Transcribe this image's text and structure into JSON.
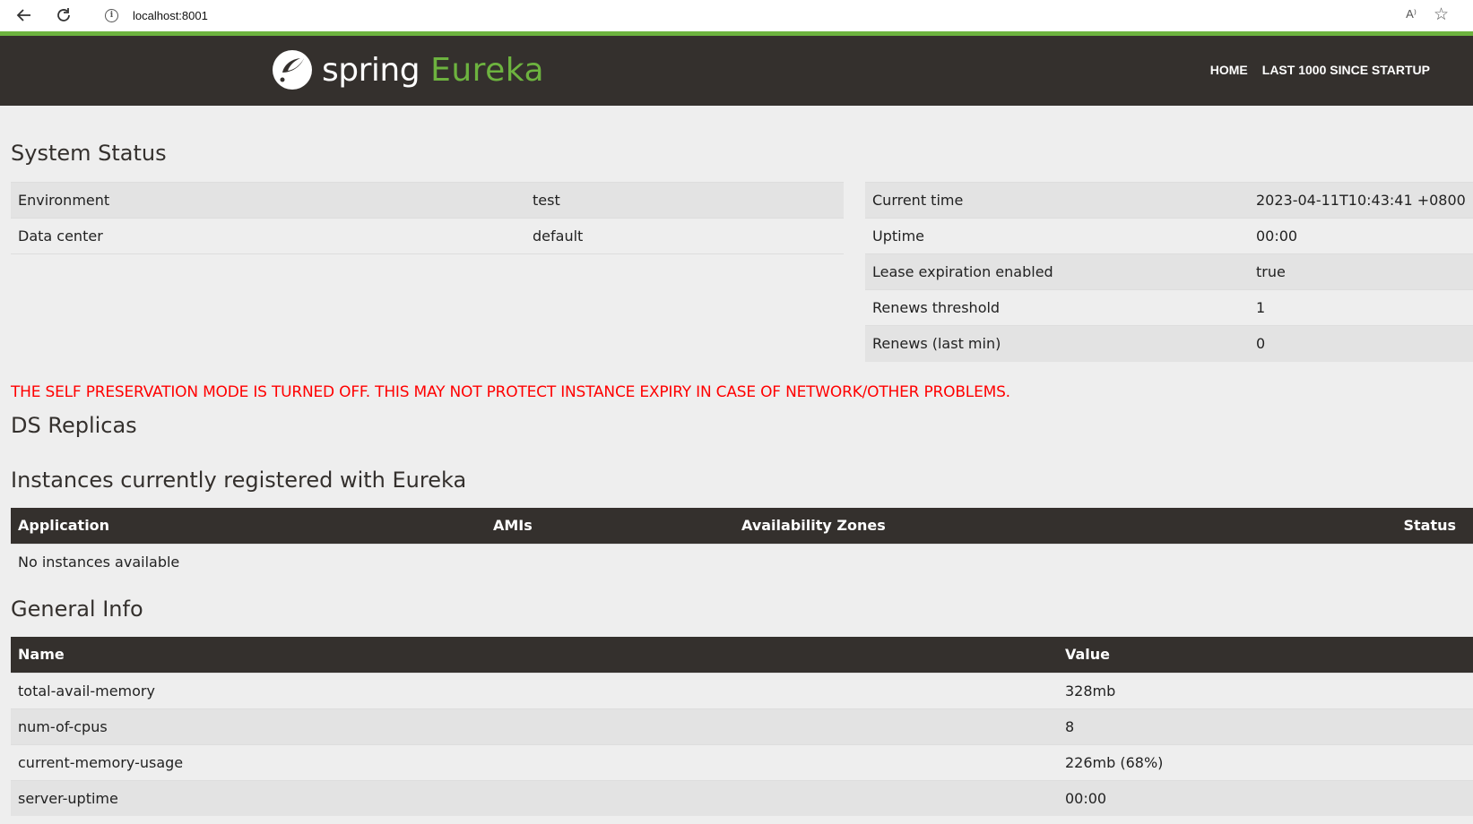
{
  "browser": {
    "url": "localhost:8001",
    "read_aloud": "A⁾"
  },
  "header": {
    "brand_spring": "spring",
    "brand_eureka": "Eureka",
    "nav": [
      "HOME",
      "LAST 1000 SINCE STARTUP"
    ]
  },
  "system_status": {
    "title": "System Status",
    "left": [
      {
        "label": "Environment",
        "value": "test"
      },
      {
        "label": "Data center",
        "value": "default"
      }
    ],
    "right": [
      {
        "label": "Current time",
        "value": "2023-04-11T10:43:41 +0800"
      },
      {
        "label": "Uptime",
        "value": "00:00"
      },
      {
        "label": "Lease expiration enabled",
        "value": "true"
      },
      {
        "label": "Renews threshold",
        "value": "1"
      },
      {
        "label": "Renews (last min)",
        "value": "0"
      }
    ]
  },
  "warning": "THE SELF PRESERVATION MODE IS TURNED OFF. THIS MAY NOT PROTECT INSTANCE EXPIRY IN CASE OF NETWORK/OTHER PROBLEMS.",
  "ds_replicas": {
    "title": "DS Replicas"
  },
  "instances": {
    "title": "Instances currently registered with Eureka",
    "columns": [
      "Application",
      "AMIs",
      "Availability Zones",
      "Status"
    ],
    "empty_message": "No instances available"
  },
  "general_info": {
    "title": "General Info",
    "columns": [
      "Name",
      "Value"
    ],
    "rows": [
      {
        "name": "total-avail-memory",
        "value": "328mb"
      },
      {
        "name": "num-of-cpus",
        "value": "8"
      },
      {
        "name": "current-memory-usage",
        "value": "226mb (68%)"
      },
      {
        "name": "server-uptime",
        "value": "00:00"
      }
    ]
  },
  "colors": {
    "header_bg": "#34302d",
    "accent_green": "#6db33f",
    "warning_red": "#ff0000"
  }
}
